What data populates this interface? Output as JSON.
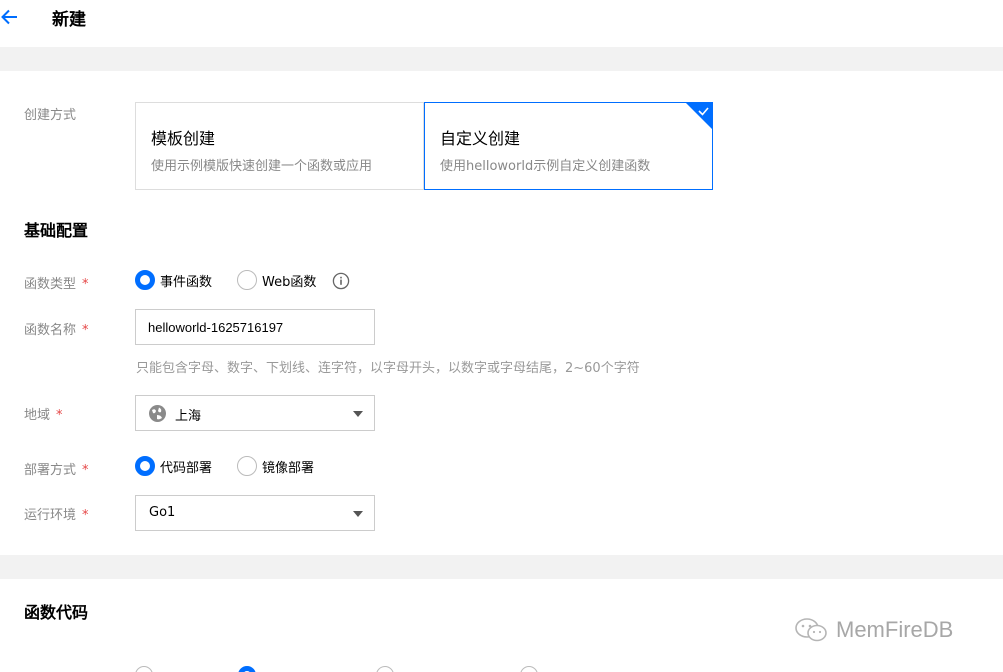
{
  "header": {
    "title": "新建"
  },
  "create_method": {
    "label": "创建方式",
    "cards": [
      {
        "title": "模板创建",
        "desc": "使用示例模版快速创建一个函数或应用",
        "selected": false
      },
      {
        "title": "自定义创建",
        "desc": "使用helloworld示例自定义创建函数",
        "selected": true
      }
    ]
  },
  "basic_config": {
    "title": "基础配置",
    "function_type": {
      "label": "函数类型",
      "options": [
        {
          "label": "事件函数",
          "checked": true
        },
        {
          "label": "Web函数",
          "checked": false
        }
      ]
    },
    "function_name": {
      "label": "函数名称",
      "value": "helloworld-1625716197",
      "hint": "只能包含字母、数字、下划线、连字符，以字母开头，以数字或字母结尾，2~60个字符"
    },
    "region": {
      "label": "地域",
      "value": "上海"
    },
    "deploy_method": {
      "label": "部署方式",
      "options": [
        {
          "label": "代码部署",
          "checked": true
        },
        {
          "label": "镜像部署",
          "checked": false
        }
      ]
    },
    "runtime": {
      "label": "运行环境",
      "value": "Go1"
    },
    "required_mark": "*"
  },
  "function_code": {
    "title": "函数代码"
  },
  "watermark": {
    "text": "MemFireDB"
  },
  "colors": {
    "accent": "#006eff",
    "required": "#e54545",
    "band": "#f2f2f2"
  }
}
